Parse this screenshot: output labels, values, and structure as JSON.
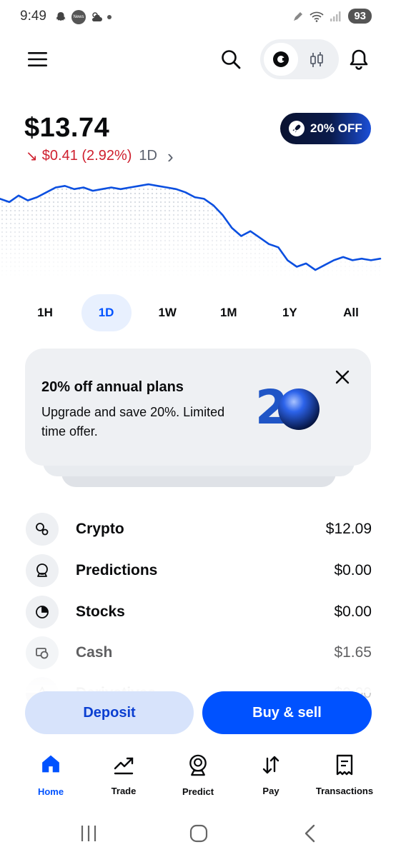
{
  "status_bar": {
    "time": "9:49",
    "battery": "93",
    "news_badge": "News"
  },
  "header": {
    "menu_icon": "hamburger-menu-icon",
    "search_icon": "search-icon",
    "toggle_primary_icon": "coinbase-c-icon",
    "toggle_secondary_icon": "candlestick-icon",
    "bell_icon": "bell-icon"
  },
  "balance": {
    "amount": "$13.74",
    "change_arrow": "↘",
    "change_value": "$0.41 (2.92%)",
    "change_period": "1D",
    "chevron": "›"
  },
  "promo_pill": {
    "label": "20% OFF",
    "icon": "rocket-icon"
  },
  "colors": {
    "accent": "#0052ff",
    "negative": "#cf202f",
    "chart_line": "#0b4fe0",
    "card_bg": "#eef0f3"
  },
  "ranges": [
    {
      "label": "1H"
    },
    {
      "label": "1D"
    },
    {
      "label": "1W"
    },
    {
      "label": "1M"
    },
    {
      "label": "1Y"
    },
    {
      "label": "All"
    }
  ],
  "promo_card": {
    "title": "20% off annual plans",
    "body": "Upgrade and save 20%. Limited time offer.",
    "graphic_text": "2",
    "close_icon": "close-icon"
  },
  "assets": [
    {
      "name": "Crypto",
      "value": "$12.09",
      "icon": "coins-icon"
    },
    {
      "name": "Predictions",
      "value": "$0.00",
      "icon": "crystal-ball-icon"
    },
    {
      "name": "Stocks",
      "value": "$0.00",
      "icon": "pie-chart-icon"
    },
    {
      "name": "Cash",
      "value": "$1.65",
      "icon": "cash-icon"
    },
    {
      "name": "Derivatives",
      "value": "$0.00",
      "icon": "derivatives-icon"
    }
  ],
  "actions": {
    "deposit": "Deposit",
    "buy_sell": "Buy & sell"
  },
  "bottom_nav": [
    {
      "label": "Home",
      "icon": "home-icon",
      "active": true
    },
    {
      "label": "Trade",
      "icon": "trend-up-icon",
      "active": false
    },
    {
      "label": "Predict",
      "icon": "crystal-ball-icon",
      "active": false
    },
    {
      "label": "Pay",
      "icon": "transfer-arrows-icon",
      "active": false
    },
    {
      "label": "Transactions",
      "icon": "receipt-icon",
      "active": false
    }
  ],
  "chart_data": {
    "type": "line",
    "period": "1D",
    "values": [
      13.98,
      13.96,
      14.0,
      13.97,
      13.99,
      14.02,
      14.05,
      14.06,
      14.04,
      14.05,
      14.03,
      14.04,
      14.05,
      14.04,
      14.05,
      14.06,
      14.07,
      14.06,
      14.05,
      14.04,
      14.02,
      13.99,
      13.98,
      13.94,
      13.88,
      13.8,
      13.75,
      13.78,
      13.74,
      13.7,
      13.68,
      13.6,
      13.56,
      13.58,
      13.54,
      13.57,
      13.6,
      13.62,
      13.6,
      13.61,
      13.6,
      13.61
    ]
  }
}
